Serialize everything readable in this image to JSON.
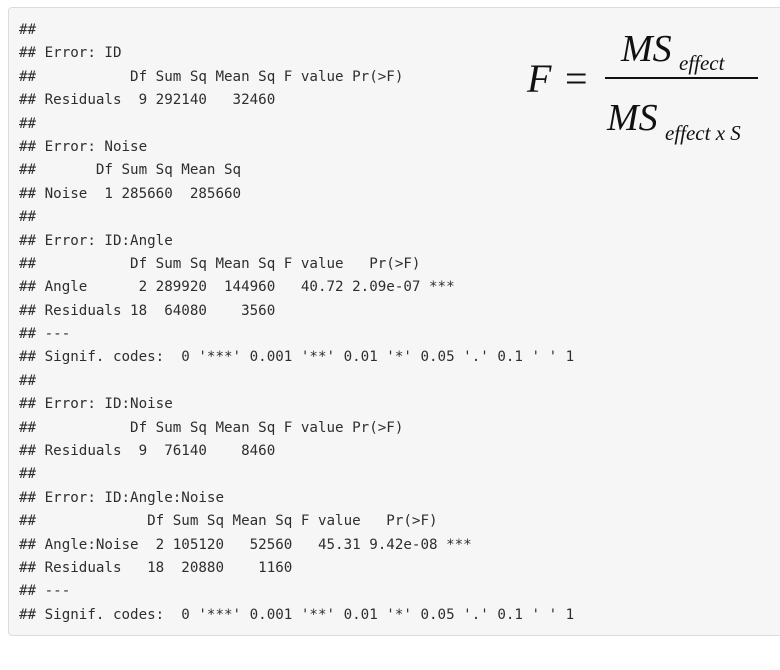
{
  "console_lines": [
    "##",
    "## Error: ID",
    "##           Df Sum Sq Mean Sq F value Pr(>F)",
    "## Residuals  9 292140   32460",
    "##",
    "## Error: Noise",
    "##       Df Sum Sq Mean Sq",
    "## Noise  1 285660  285660",
    "##",
    "## Error: ID:Angle",
    "##           Df Sum Sq Mean Sq F value   Pr(>F)",
    "## Angle      2 289920  144960   40.72 2.09e-07 ***",
    "## Residuals 18  64080    3560",
    "## ---",
    "## Signif. codes:  0 '***' 0.001 '**' 0.01 '*' 0.05 '.' 0.1 ' ' 1",
    "##",
    "## Error: ID:Noise",
    "##           Df Sum Sq Mean Sq F value Pr(>F)",
    "## Residuals  9  76140    8460",
    "##",
    "## Error: ID:Angle:Noise",
    "##             Df Sum Sq Mean Sq F value   Pr(>F)",
    "## Angle:Noise  2 105120   52560   45.31 9.42e-08 ***",
    "## Residuals   18  20880    1160",
    "## ---",
    "## Signif. codes:  0 '***' 0.001 '**' 0.01 '*' 0.05 '.' 0.1 ' ' 1"
  ],
  "formula": {
    "lhs": "F",
    "equals": "=",
    "numerator_base": "MS",
    "numerator_subscript": "effect",
    "denominator_base": "MS",
    "denominator_subscript": "effect x S"
  }
}
